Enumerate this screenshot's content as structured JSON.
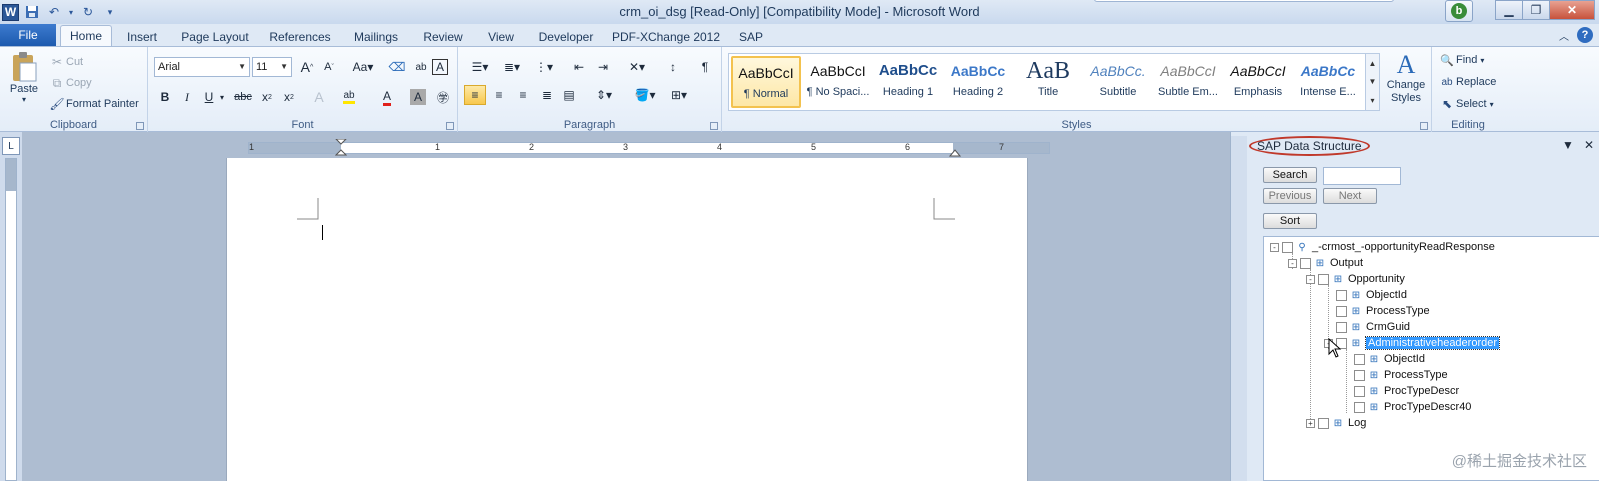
{
  "window": {
    "title": "crm_oi_dsg [Read-Only] [Compatibility Mode] - Microsoft Word",
    "app_logo": "W",
    "controls": [
      "minimize",
      "restore",
      "close"
    ]
  },
  "quick_access": {
    "icons": [
      "save-icon",
      "undo-icon",
      "redo-icon",
      "customize-icon"
    ]
  },
  "tabs": {
    "file": "File",
    "items": [
      "Home",
      "Insert",
      "Page Layout",
      "References",
      "Mailings",
      "Review",
      "View",
      "Developer",
      "PDF-XChange 2012",
      "SAP"
    ],
    "active": "Home"
  },
  "clipboard": {
    "label": "Clipboard",
    "paste": "Paste",
    "cut": "Cut",
    "copy": "Copy",
    "format_painter": "Format Painter"
  },
  "font": {
    "label": "Font",
    "family": "Arial",
    "size": "11"
  },
  "paragraph": {
    "label": "Paragraph"
  },
  "styles": {
    "label": "Styles",
    "items": [
      {
        "sample": "AaBbCcI",
        "name": "¶ Normal"
      },
      {
        "sample": "AaBbCcI",
        "name": "¶ No Spaci..."
      },
      {
        "sample": "AaBbCc",
        "name": "Heading 1"
      },
      {
        "sample": "AaBbCc",
        "name": "Heading 2"
      },
      {
        "sample": "AaB",
        "name": "Title"
      },
      {
        "sample": "AaBbCc.",
        "name": "Subtitle"
      },
      {
        "sample": "AaBbCcI",
        "name": "Subtle Em..."
      },
      {
        "sample": "AaBbCcI",
        "name": "Emphasis"
      },
      {
        "sample": "AaBbCc",
        "name": "Intense E..."
      }
    ],
    "change_styles": "Change Styles"
  },
  "editing": {
    "label": "Editing",
    "find": "Find",
    "replace": "Replace",
    "select": "Select"
  },
  "ruler": {
    "numbers": [
      "1",
      "1",
      "2",
      "3",
      "4",
      "5",
      "6",
      "7"
    ]
  },
  "panel": {
    "title": "SAP Data Structure",
    "search": "Search",
    "previous": "Previous",
    "next": "Next",
    "sort": "Sort",
    "tree": [
      {
        "label": "_-crmost_-opportunityReadResponse",
        "level": 0,
        "expander": "-"
      },
      {
        "label": "Output",
        "level": 1,
        "expander": "-"
      },
      {
        "label": "Opportunity",
        "level": 2,
        "expander": "-"
      },
      {
        "label": "ObjectId",
        "level": 3,
        "expander": ""
      },
      {
        "label": "ProcessType",
        "level": 3,
        "expander": ""
      },
      {
        "label": "CrmGuid",
        "level": 3,
        "expander": ""
      },
      {
        "label": "Administrativeheaderorder",
        "level": 3,
        "expander": "-",
        "selected": true
      },
      {
        "label": "ObjectId",
        "level": 4,
        "expander": ""
      },
      {
        "label": "ProcessType",
        "level": 4,
        "expander": ""
      },
      {
        "label": "ProcTypeDescr",
        "level": 4,
        "expander": ""
      },
      {
        "label": "ProcTypeDescr40",
        "level": 4,
        "expander": ""
      },
      {
        "label": "Log",
        "level": 2,
        "expander": "+"
      }
    ]
  },
  "watermark": "@稀土掘金技术社区",
  "colors": {
    "file_tab": "#2b5797",
    "selection": "#3399ff",
    "highlight_ring": "#c0392b"
  }
}
